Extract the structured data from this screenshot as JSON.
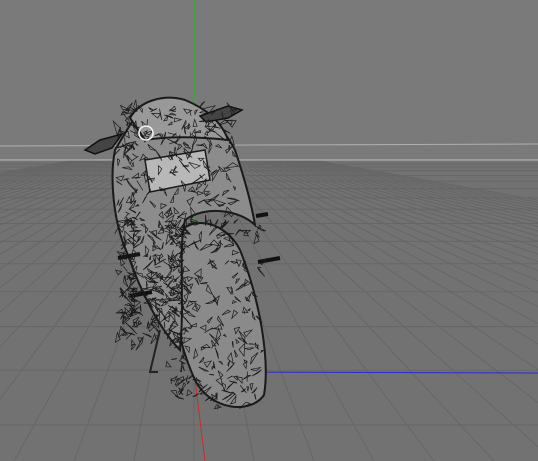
{
  "viewport": {
    "background_color": "#7a7a7a",
    "grid_color": "#6b6b6b",
    "horizon_color": "#c8c8c8",
    "axis_colors": {
      "x": "#2a2acf",
      "y": "#1fbf1f",
      "z": "#cc2a2a"
    }
  },
  "model": {
    "name": "motorcycle-wireframe",
    "display_mode": "wireframe",
    "wire_color": "#1a1a1a",
    "fill_color": "#8c8c8c"
  },
  "cursor": {
    "icon": "circle-cursor-icon"
  }
}
